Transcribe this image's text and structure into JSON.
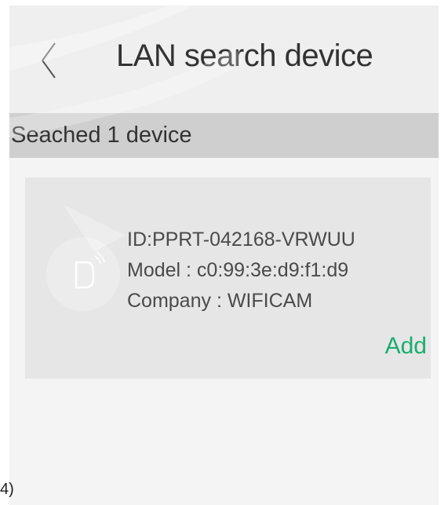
{
  "header": {
    "back_icon": "chevron-left-icon",
    "title": "LAN search device"
  },
  "section": {
    "label": "Seached 1 device"
  },
  "devices": [
    {
      "icon": "camera-wifi-icon",
      "id_text": "ID:PPRT-042168-VRWUU",
      "model_text": "Model : c0:99:3e:d9:f1:d9",
      "company_text": "Company : WIFICAM",
      "action_label": "Add"
    }
  ],
  "stray_text": "4)",
  "colors": {
    "accent": "#1aad6f",
    "header_bg": "#efefef",
    "section_bg": "#cfcfcf",
    "card_bg": "#e6e6e6"
  }
}
